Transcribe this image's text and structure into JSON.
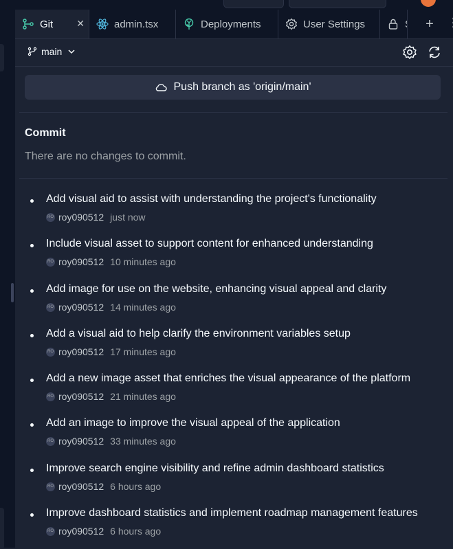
{
  "tabs": [
    {
      "label": "Git",
      "icon": "git-icon",
      "active": true,
      "closable": true
    },
    {
      "label": "admin.tsx",
      "icon": "react-icon"
    },
    {
      "label": "Deployments",
      "icon": "deployments-icon"
    },
    {
      "label": "User Settings",
      "icon": "gear-icon"
    },
    {
      "label": "S",
      "icon": "lock-icon"
    }
  ],
  "branch": {
    "name": "main"
  },
  "push_button": {
    "label": "Push branch as 'origin/main'"
  },
  "commit": {
    "heading": "Commit",
    "empty_message": "There are no changes to commit."
  },
  "history": [
    {
      "message": "Add visual aid to assist with understanding the project's functionality",
      "author": "roy090512",
      "time": "just now",
      "avatar": "RO"
    },
    {
      "message": "Include visual asset to support content for enhanced understanding",
      "author": "roy090512",
      "time": "10 minutes ago",
      "avatar": "RO"
    },
    {
      "message": "Add image for use on the website, enhancing visual appeal and clarity",
      "author": "roy090512",
      "time": "14 minutes ago",
      "avatar": "RO"
    },
    {
      "message": "Add a visual aid to help clarify the environment variables setup",
      "author": "roy090512",
      "time": "17 minutes ago",
      "avatar": "RO"
    },
    {
      "message": "Add a new image asset that enriches the visual appearance of the platform",
      "author": "roy090512",
      "time": "21 minutes ago",
      "avatar": "RO"
    },
    {
      "message": "Add an image to improve the visual appeal of the application",
      "author": "roy090512",
      "time": "33 minutes ago",
      "avatar": "RO"
    },
    {
      "message": "Improve search engine visibility and refine admin dashboard statistics",
      "author": "roy090512",
      "time": "6 hours ago",
      "avatar": "RO"
    },
    {
      "message": "Improve dashboard statistics and implement roadmap management features",
      "author": "roy090512",
      "time": "6 hours ago",
      "avatar": "RO"
    }
  ],
  "colors": {
    "background": "#1c2333",
    "tabbar": "#0e1525",
    "button": "#2b3245",
    "text": "#f5f9fc",
    "muted": "#9da2a6"
  }
}
